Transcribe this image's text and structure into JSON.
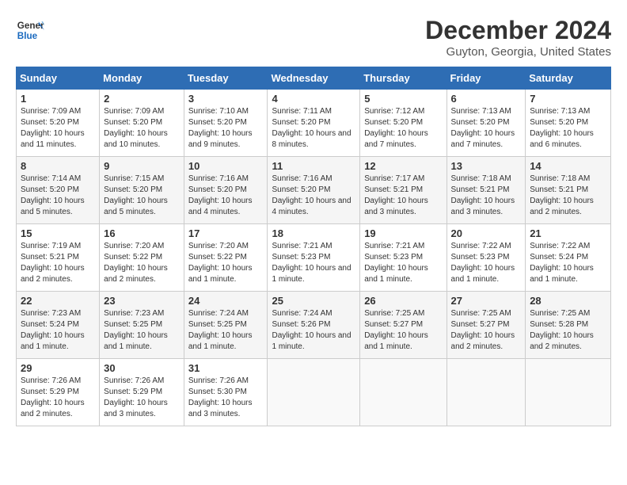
{
  "header": {
    "logo_line1": "General",
    "logo_line2": "Blue",
    "month": "December 2024",
    "location": "Guyton, Georgia, United States"
  },
  "weekdays": [
    "Sunday",
    "Monday",
    "Tuesday",
    "Wednesday",
    "Thursday",
    "Friday",
    "Saturday"
  ],
  "weeks": [
    [
      {
        "day": "1",
        "sunrise": "7:09 AM",
        "sunset": "5:20 PM",
        "daylight": "10 hours and 11 minutes."
      },
      {
        "day": "2",
        "sunrise": "7:09 AM",
        "sunset": "5:20 PM",
        "daylight": "10 hours and 10 minutes."
      },
      {
        "day": "3",
        "sunrise": "7:10 AM",
        "sunset": "5:20 PM",
        "daylight": "10 hours and 9 minutes."
      },
      {
        "day": "4",
        "sunrise": "7:11 AM",
        "sunset": "5:20 PM",
        "daylight": "10 hours and 8 minutes."
      },
      {
        "day": "5",
        "sunrise": "7:12 AM",
        "sunset": "5:20 PM",
        "daylight": "10 hours and 7 minutes."
      },
      {
        "day": "6",
        "sunrise": "7:13 AM",
        "sunset": "5:20 PM",
        "daylight": "10 hours and 7 minutes."
      },
      {
        "day": "7",
        "sunrise": "7:13 AM",
        "sunset": "5:20 PM",
        "daylight": "10 hours and 6 minutes."
      }
    ],
    [
      {
        "day": "8",
        "sunrise": "7:14 AM",
        "sunset": "5:20 PM",
        "daylight": "10 hours and 5 minutes."
      },
      {
        "day": "9",
        "sunrise": "7:15 AM",
        "sunset": "5:20 PM",
        "daylight": "10 hours and 5 minutes."
      },
      {
        "day": "10",
        "sunrise": "7:16 AM",
        "sunset": "5:20 PM",
        "daylight": "10 hours and 4 minutes."
      },
      {
        "day": "11",
        "sunrise": "7:16 AM",
        "sunset": "5:20 PM",
        "daylight": "10 hours and 4 minutes."
      },
      {
        "day": "12",
        "sunrise": "7:17 AM",
        "sunset": "5:21 PM",
        "daylight": "10 hours and 3 minutes."
      },
      {
        "day": "13",
        "sunrise": "7:18 AM",
        "sunset": "5:21 PM",
        "daylight": "10 hours and 3 minutes."
      },
      {
        "day": "14",
        "sunrise": "7:18 AM",
        "sunset": "5:21 PM",
        "daylight": "10 hours and 2 minutes."
      }
    ],
    [
      {
        "day": "15",
        "sunrise": "7:19 AM",
        "sunset": "5:21 PM",
        "daylight": "10 hours and 2 minutes."
      },
      {
        "day": "16",
        "sunrise": "7:20 AM",
        "sunset": "5:22 PM",
        "daylight": "10 hours and 2 minutes."
      },
      {
        "day": "17",
        "sunrise": "7:20 AM",
        "sunset": "5:22 PM",
        "daylight": "10 hours and 1 minute."
      },
      {
        "day": "18",
        "sunrise": "7:21 AM",
        "sunset": "5:23 PM",
        "daylight": "10 hours and 1 minute."
      },
      {
        "day": "19",
        "sunrise": "7:21 AM",
        "sunset": "5:23 PM",
        "daylight": "10 hours and 1 minute."
      },
      {
        "day": "20",
        "sunrise": "7:22 AM",
        "sunset": "5:23 PM",
        "daylight": "10 hours and 1 minute."
      },
      {
        "day": "21",
        "sunrise": "7:22 AM",
        "sunset": "5:24 PM",
        "daylight": "10 hours and 1 minute."
      }
    ],
    [
      {
        "day": "22",
        "sunrise": "7:23 AM",
        "sunset": "5:24 PM",
        "daylight": "10 hours and 1 minute."
      },
      {
        "day": "23",
        "sunrise": "7:23 AM",
        "sunset": "5:25 PM",
        "daylight": "10 hours and 1 minute."
      },
      {
        "day": "24",
        "sunrise": "7:24 AM",
        "sunset": "5:25 PM",
        "daylight": "10 hours and 1 minute."
      },
      {
        "day": "25",
        "sunrise": "7:24 AM",
        "sunset": "5:26 PM",
        "daylight": "10 hours and 1 minute."
      },
      {
        "day": "26",
        "sunrise": "7:25 AM",
        "sunset": "5:27 PM",
        "daylight": "10 hours and 1 minute."
      },
      {
        "day": "27",
        "sunrise": "7:25 AM",
        "sunset": "5:27 PM",
        "daylight": "10 hours and 2 minutes."
      },
      {
        "day": "28",
        "sunrise": "7:25 AM",
        "sunset": "5:28 PM",
        "daylight": "10 hours and 2 minutes."
      }
    ],
    [
      {
        "day": "29",
        "sunrise": "7:26 AM",
        "sunset": "5:29 PM",
        "daylight": "10 hours and 2 minutes."
      },
      {
        "day": "30",
        "sunrise": "7:26 AM",
        "sunset": "5:29 PM",
        "daylight": "10 hours and 3 minutes."
      },
      {
        "day": "31",
        "sunrise": "7:26 AM",
        "sunset": "5:30 PM",
        "daylight": "10 hours and 3 minutes."
      },
      null,
      null,
      null,
      null
    ]
  ]
}
